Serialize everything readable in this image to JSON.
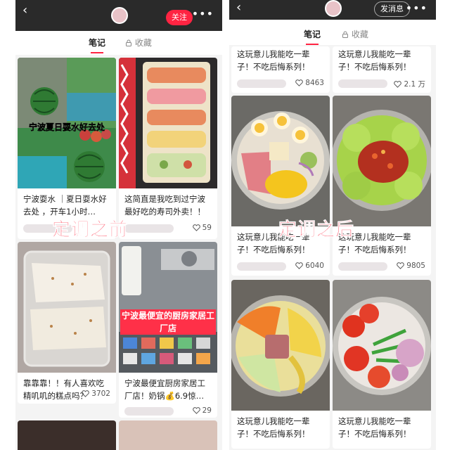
{
  "left": {
    "follow_label": "关注",
    "tabs": [
      {
        "label": "笔记"
      },
      {
        "label": "收藏"
      }
    ],
    "overlay": "定调之前",
    "cards": [
      {
        "title": "宁波耍水 ｜夏日耍水好去处 ，开车1小时…",
        "image_caption": "宁波夏日耍水好去处",
        "likes": "",
        "image": "watermelon-lake"
      },
      {
        "title": "这简直是我吃到过宁波最好吃的寿司外卖！！",
        "likes": "59",
        "image": "sushi"
      },
      {
        "title": "靠靠靠！！有人喜欢吃精叽叽的糕点吗？",
        "likes": "3702",
        "image": "pastry"
      },
      {
        "title": "宁波最便宜厨房家居工厂店！奶锅💰6.9惊…",
        "image_caption": "宁波最便宜的厨房家居工厂店",
        "likes": "29",
        "image": "store"
      }
    ]
  },
  "right": {
    "follow_label": "发消息",
    "tabs": [
      {
        "label": "笔记"
      },
      {
        "label": "收藏"
      }
    ],
    "overlay": "定调之后",
    "top_cards": [
      {
        "title": "这玩意儿我能吃一辈子！不吃后悔系列！",
        "likes": "8463"
      },
      {
        "title": "这玩意儿我能吃一辈子！不吃后悔系列！",
        "likes": "2.1 万"
      }
    ],
    "cards": [
      {
        "title": "这玩意儿我能吃一辈子！不吃后悔系列！",
        "likes": "6040",
        "image": "egg-salad"
      },
      {
        "title": "这玩意儿我能吃一辈子！不吃后悔系列！",
        "likes": "9805",
        "image": "lettuce-chili"
      },
      {
        "title": "这玩意儿我能吃一辈子！不吃后悔系列！",
        "likes": "",
        "image": "carrot-potato"
      },
      {
        "title": "这玩意儿我能吃一辈子！不吃后悔系列！",
        "likes": "",
        "image": "tomato-onion"
      }
    ]
  },
  "colors": {
    "accent": "#ff2442",
    "overlay": "#ff3048",
    "topbar": "#2a2a2a"
  }
}
